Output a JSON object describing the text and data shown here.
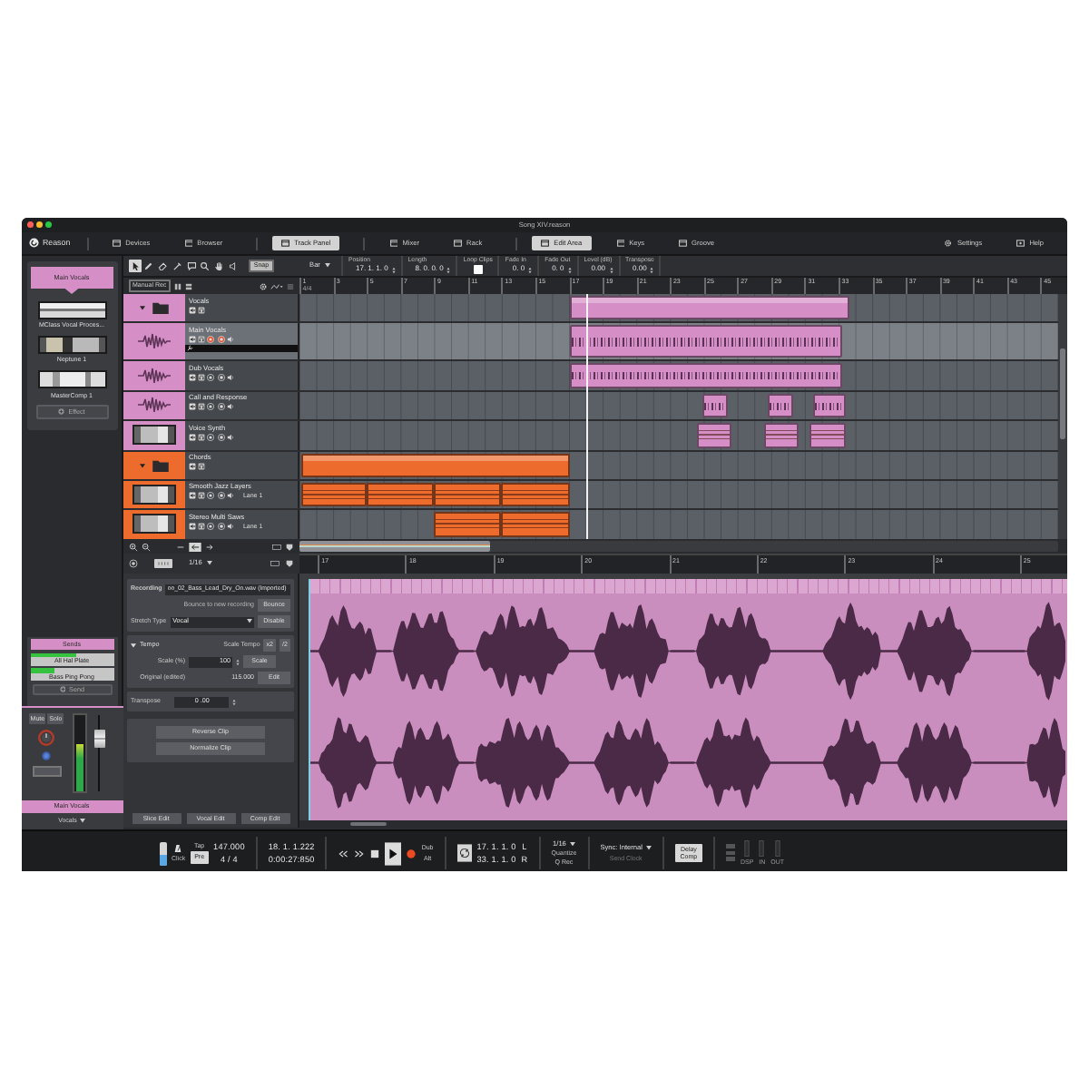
{
  "window": {
    "title": "Song XIV.reason"
  },
  "toolbar": {
    "logo": "Reason",
    "items": [
      {
        "label": "Devices",
        "selected": false
      },
      {
        "label": "Browser",
        "selected": false
      },
      {
        "label": "Track Panel",
        "selected": true
      },
      {
        "label": "Mixer",
        "selected": false
      },
      {
        "label": "Rack",
        "selected": false
      },
      {
        "label": "Edit Area",
        "selected": true
      },
      {
        "label": "Keys",
        "selected": false
      },
      {
        "label": "Groove",
        "selected": false
      }
    ],
    "right": [
      {
        "kind": "settings",
        "label": "Settings"
      },
      {
        "kind": "help",
        "label": "Help"
      }
    ]
  },
  "device_panel": {
    "title": "Main Vocals",
    "devices": [
      {
        "name": "MClass Vocal Proces..."
      },
      {
        "name": "Neptune 1"
      },
      {
        "name": "MasterComp 1"
      }
    ],
    "add_button": "Effect"
  },
  "sends": {
    "title": "Sends",
    "items": [
      {
        "label": "All Hal Plate",
        "level": 0.55
      },
      {
        "label": "Bass Ping Pong",
        "level": 0.3
      }
    ],
    "add_button": "Send"
  },
  "channel": {
    "mute": "Mute",
    "solo": "Solo",
    "meter": {
      "level": 0.62
    },
    "fader": {
      "level": 0.75
    },
    "name": "Main Vocals",
    "group": "Vocals"
  },
  "edit_tools": {
    "tools": [
      {
        "kind": "pointer",
        "selected": true
      },
      {
        "kind": "pencil",
        "selected": false
      },
      {
        "kind": "eraser",
        "selected": false
      },
      {
        "kind": "razor",
        "selected": false
      },
      {
        "kind": "comment",
        "selected": false
      },
      {
        "kind": "magnifier",
        "selected": false
      },
      {
        "kind": "hand",
        "selected": false
      },
      {
        "kind": "speaker",
        "selected": false
      }
    ],
    "snap": {
      "label": "Snap",
      "on": true
    },
    "manual_rec": "Manual Rec"
  },
  "inspector": {
    "mode": "Bar",
    "fields": [
      {
        "kind": "value",
        "label": "Position",
        "value": "17. 1. 1. 0"
      },
      {
        "kind": "value",
        "label": "Length",
        "value": "8. 0. 0. 0"
      },
      {
        "kind": "checkbox",
        "label": "Loop Clips",
        "checked": false
      },
      {
        "kind": "value",
        "label": "Fade In",
        "value": "0. 0"
      },
      {
        "kind": "value",
        "label": "Fade Out",
        "value": "0. 0"
      },
      {
        "kind": "value",
        "label": "Level (dB)",
        "value": "0.00"
      },
      {
        "kind": "value",
        "label": "Transpose",
        "value": "0.00"
      }
    ]
  },
  "ruler": {
    "signature": "4/4",
    "marks": [
      "1",
      "3",
      "5",
      "7",
      "9",
      "11",
      "13",
      "15",
      "17",
      "19",
      "21",
      "23",
      "25",
      "27",
      "29",
      "31",
      "33",
      "35",
      "37",
      "39",
      "41",
      "43",
      "45"
    ]
  },
  "tracks": [
    {
      "name": "Vocals",
      "kind": "folder",
      "color": "#d68fc6",
      "expanded": true,
      "selected": false,
      "children": [
        {
          "name": "Main Vocals",
          "kind": "audio",
          "selected": true,
          "armed": true
        },
        {
          "name": "Dub Vocals",
          "kind": "audio",
          "selected": false,
          "armed": false
        },
        {
          "name": "Call and Response",
          "kind": "audio",
          "selected": false,
          "armed": false
        },
        {
          "name": "Voice Synth",
          "kind": "instrument",
          "selected": false,
          "armed": false
        }
      ]
    },
    {
      "name": "Chords",
      "kind": "folder",
      "color": "#ec6b2d",
      "expanded": true,
      "selected": false,
      "children": [
        {
          "name": "Smooth Jazz Layers",
          "kind": "instrument",
          "selected": false,
          "armed": false,
          "lane": "Lane 1"
        },
        {
          "name": "Stereo Multi Saws",
          "kind": "instrument",
          "selected": false,
          "armed": false,
          "lane": "Lane 1"
        }
      ]
    }
  ],
  "clip_editor": {
    "snap": "1/16",
    "ruler": [
      "17",
      "18",
      "19",
      "20",
      "21",
      "22",
      "23",
      "24",
      "25"
    ],
    "properties": {
      "recording_label": "Recording",
      "recording": "oo_02_Bass_Lead_Dry_On.wav (Imported)",
      "bounce_hint": "Bounce to new recording",
      "bounce": "Bounce",
      "stretch_label": "Stretch Type",
      "stretch": "Vocal",
      "disable": "Disable",
      "tempo": {
        "title": "Tempo",
        "expanded": true,
        "scale_tempo": "Scale Tempo",
        "double": "x2",
        "half": "/2",
        "scale_label": "Scale (%)",
        "scale": "100",
        "scale_button": "Scale",
        "original_label": "Original (edited)",
        "original": "115.000",
        "edit": "Edit"
      },
      "transpose_label": "Transpose",
      "transpose": "0 .00",
      "reverse": "Reverse Clip",
      "normalize": "Normalize Clip"
    },
    "modes": [
      {
        "label": "Slice Edit"
      },
      {
        "label": "Vocal Edit"
      },
      {
        "label": "Comp Edit"
      }
    ]
  },
  "transport": {
    "click_volume": {
      "level": 0.45
    },
    "click": "Click",
    "tap": "Tap",
    "pre": {
      "label": "Pre",
      "on": true
    },
    "tempo": "147.000",
    "signature": "4 / 4",
    "position": "18. 1. 1.222",
    "time": "0:00:27:850",
    "playing": true,
    "dub": "Dub",
    "alt": "Alt",
    "loop": {
      "on": true
    },
    "loop_left": "17. 1. 1. 0",
    "left": "L",
    "loop_right": "33. 1. 1. 0",
    "right": "R",
    "quantize_value": "1/16",
    "quantize": "Quantize",
    "q_rec": "Q Rec",
    "sync": "Sync: Internal",
    "send_clock": {
      "label": "Send Clock",
      "disabled": true
    },
    "delay_comp": {
      "label": "Delay Comp",
      "on": true
    },
    "meters": [
      "DSP",
      "IN",
      "OUT"
    ]
  }
}
